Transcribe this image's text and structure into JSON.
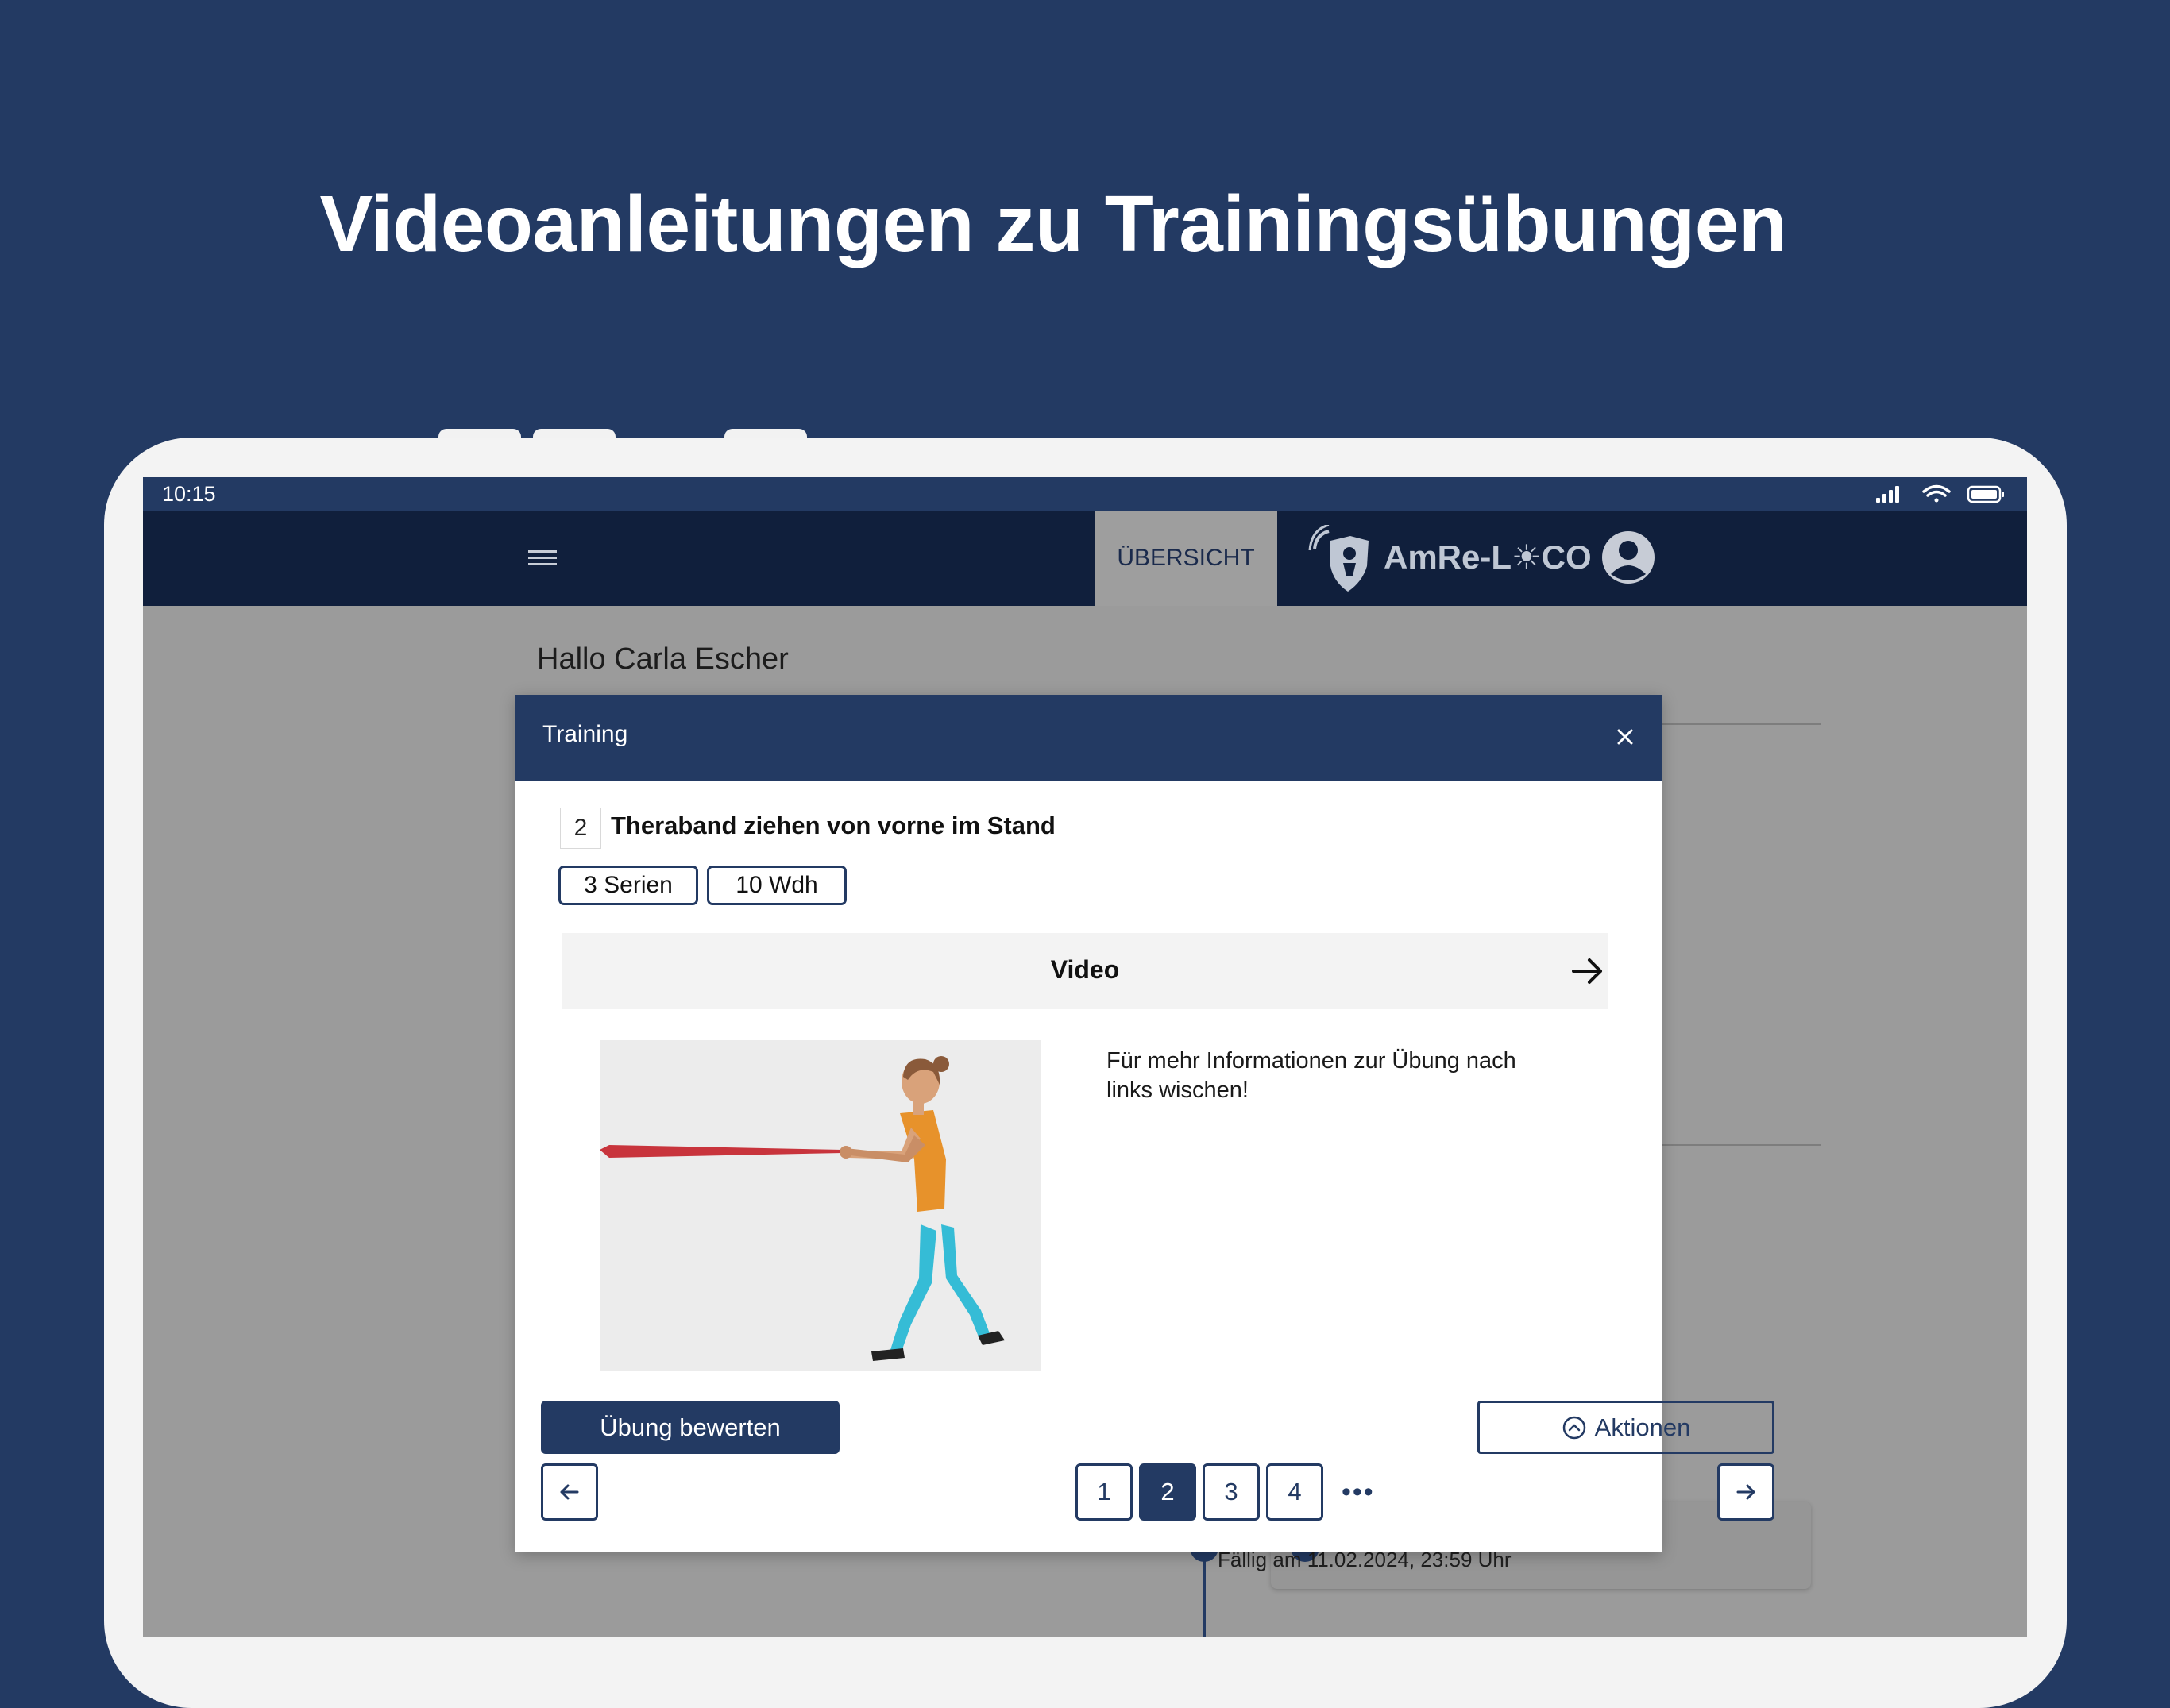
{
  "headline": "Videoanleitungen zu Trainingsübungen",
  "status_bar": {
    "time": "10:15"
  },
  "app_bar": {
    "tab_overview": "ÜBERSICHT",
    "logo_text": "AmRe-L☀CO"
  },
  "background": {
    "greeting": "Hallo Carla Escher",
    "due_text": "Fällig am 11.02.2024, 23:59 Uhr"
  },
  "modal": {
    "title": "Training",
    "exercise": {
      "number": "2",
      "title": "Theraband ziehen von vorne im Stand",
      "series": "3 Serien",
      "reps": "10 Wdh"
    },
    "video_label": "Video",
    "swipe_hint": "Für mehr Informationen zur Übung nach links wischen!",
    "rate_button": "Übung bewerten",
    "actions_button": "Aktionen",
    "pagination": {
      "pages": [
        "1",
        "2",
        "3",
        "4"
      ],
      "current": "2",
      "more": "•••"
    }
  },
  "colors": {
    "page_bg": "#233a63",
    "primary": "#233a63",
    "app_bar": "#101f3c",
    "band": "#c8343c",
    "shirt": "#e7922b",
    "leggings": "#35bcd6"
  }
}
